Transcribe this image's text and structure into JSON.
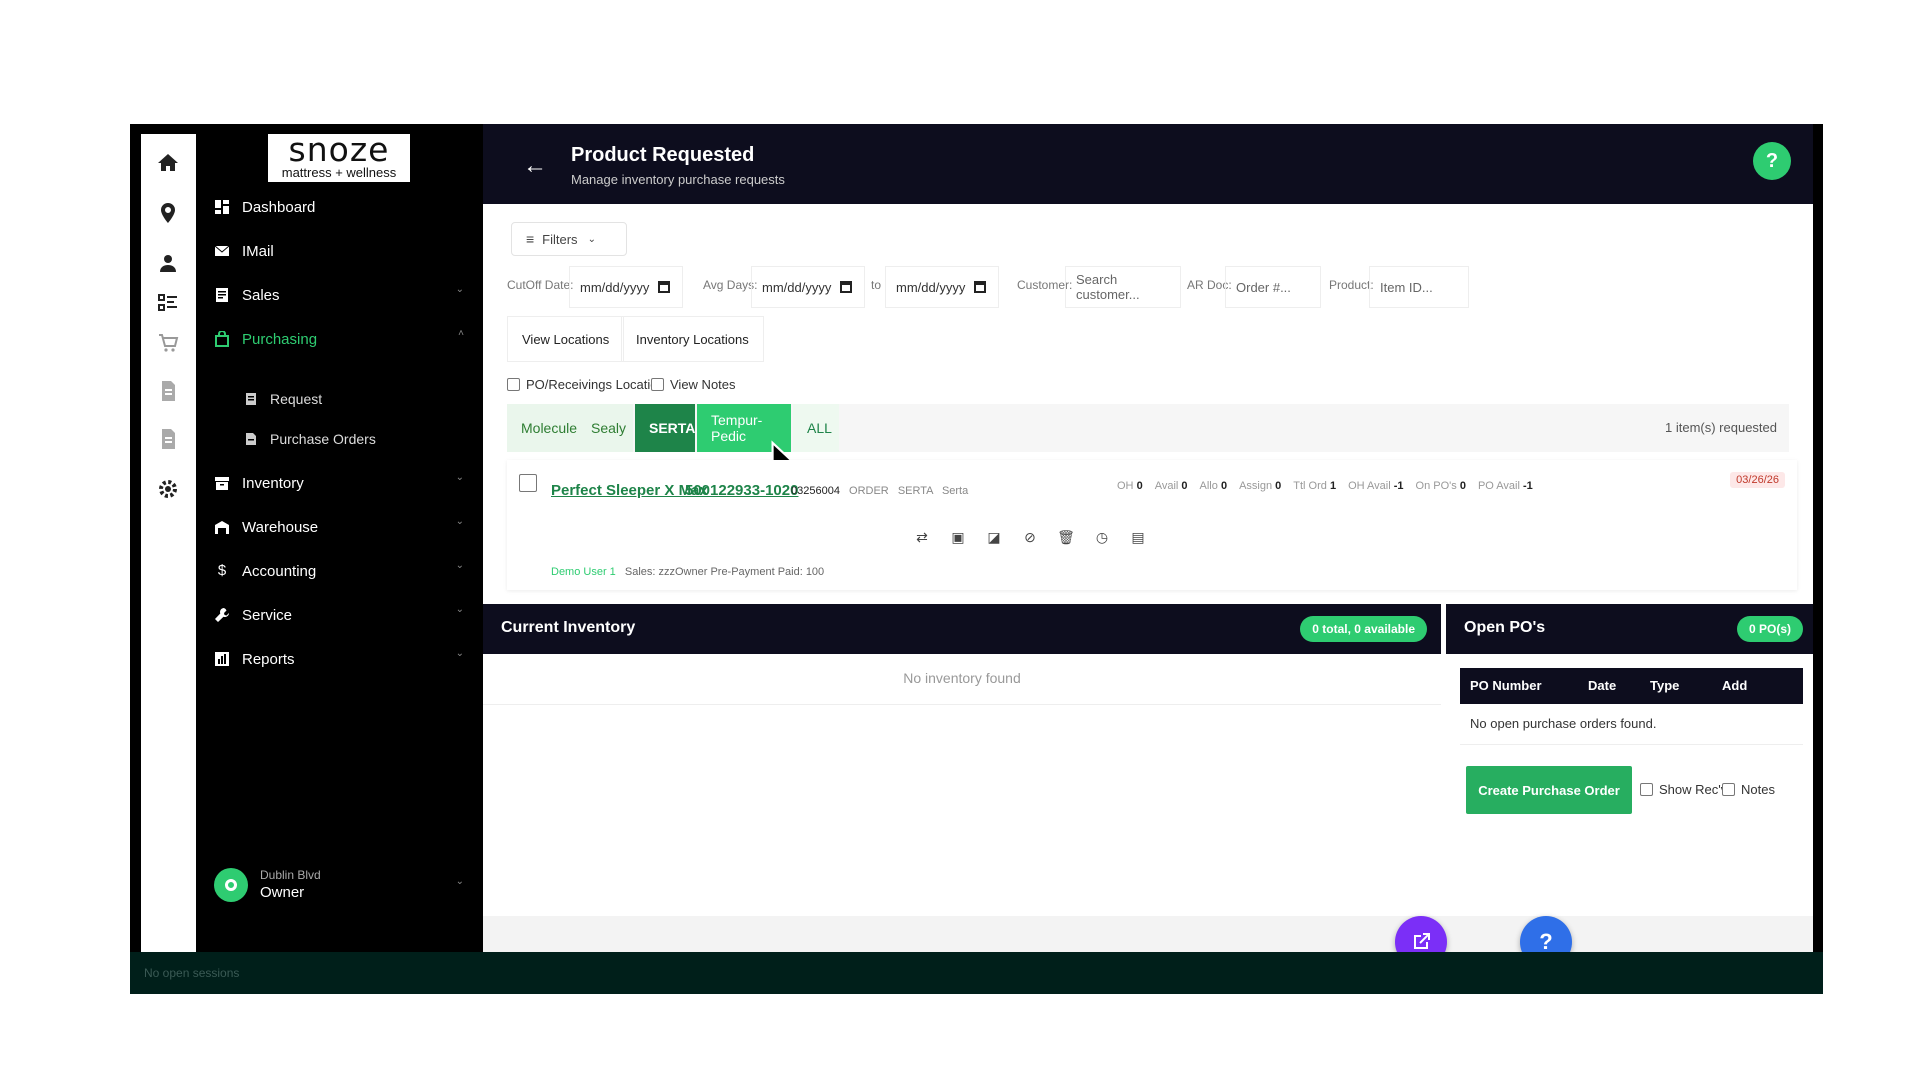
{
  "rail": {
    "icons": [
      "home-icon",
      "location-pin-icon",
      "user-icon",
      "checklist-icon",
      "cart-icon",
      "document-icon",
      "document-2-icon",
      "gear-icon"
    ]
  },
  "brand": {
    "line1": "snoze",
    "line2": "mattress + wellness"
  },
  "sidebar": {
    "items": [
      {
        "label": "Dashboard",
        "icon": "dashboard-icon"
      },
      {
        "label": "IMail",
        "icon": "mail-icon"
      },
      {
        "label": "Sales",
        "icon": "receipt-icon"
      },
      {
        "label": "Purchasing",
        "icon": "bag-icon"
      },
      {
        "label": "Inventory",
        "icon": "box-icon"
      },
      {
        "label": "Warehouse",
        "icon": "warehouse-icon"
      },
      {
        "label": "Accounting",
        "icon": "dollar-icon"
      },
      {
        "label": "Service",
        "icon": "wrench-icon"
      },
      {
        "label": "Reports",
        "icon": "chart-icon"
      }
    ],
    "sub_items": [
      {
        "label": "Request"
      },
      {
        "label": "Purchase Orders"
      }
    ],
    "user": {
      "location": "Dublin Blvd",
      "role": "Owner"
    }
  },
  "header": {
    "title": "Product Requested",
    "subtitle": "Manage inventory purchase requests",
    "help": "?"
  },
  "filters": {
    "button": "Filters",
    "cutoff_label": "CutOff Date:",
    "cutoff_value": "mm/dd/yyyy",
    "avg_label": "Avg Days:",
    "avg_from": "mm/dd/yyyy",
    "to_label": "to",
    "avg_to": "mm/dd/yyyy",
    "customer_label": "Customer:",
    "customer_placeholder": "Search customer...",
    "ar_label": "AR Doc:",
    "ar_placeholder": "Order #...",
    "product_label": "Product:",
    "product_placeholder": "Item ID..."
  },
  "location_buttons": {
    "view": "View Locations",
    "inventory": "Inventory Locations"
  },
  "checks": {
    "po_receiving": "PO/Receivings Location",
    "view_notes": "View Notes"
  },
  "brand_tabs": [
    "Molecule",
    "Sealy",
    "SERTA",
    "Tempur-Pedic",
    "ALL"
  ],
  "request_count": "1 item(s) requested",
  "item": {
    "name": "Perfect Sleeper X Max",
    "sku": "500122933-1020",
    "code": "03256004",
    "type": "ORDER",
    "brand_code": "SERTA",
    "brand": "Serta",
    "stats": [
      {
        "label": "OH",
        "value": "0"
      },
      {
        "label": "Avail",
        "value": "0"
      },
      {
        "label": "Allo",
        "value": "0"
      },
      {
        "label": "Assign",
        "value": "0"
      },
      {
        "label": "Ttl Ord",
        "value": "1"
      },
      {
        "label": "OH Avail",
        "value": "-1"
      },
      {
        "label": "On PO's",
        "value": "0"
      },
      {
        "label": "PO Avail",
        "value": "-1"
      }
    ],
    "date": "03/26/26",
    "note_user": "Demo User 1",
    "note_text": "Sales: zzzOwner  Pre-Payment  Paid: 100"
  },
  "inventory": {
    "title": "Current Inventory",
    "badge": "0 total, 0 available",
    "empty": "No inventory found"
  },
  "open_po": {
    "title": "Open PO's",
    "badge": "0 PO(s)",
    "columns": [
      "PO Number",
      "Date",
      "Type",
      "Add"
    ],
    "empty": "No open purchase orders found.",
    "create_button": "Create Purchase Order",
    "show_recv": "Show Rec'v",
    "notes": "Notes"
  },
  "fab": {
    "help": "?"
  },
  "status": "No open sessions",
  "colors": {
    "accent": "#2ecc71",
    "header": "#0d0d1e",
    "fab_edit": "#7b2ff7",
    "fab_help": "#2f6fe8"
  }
}
